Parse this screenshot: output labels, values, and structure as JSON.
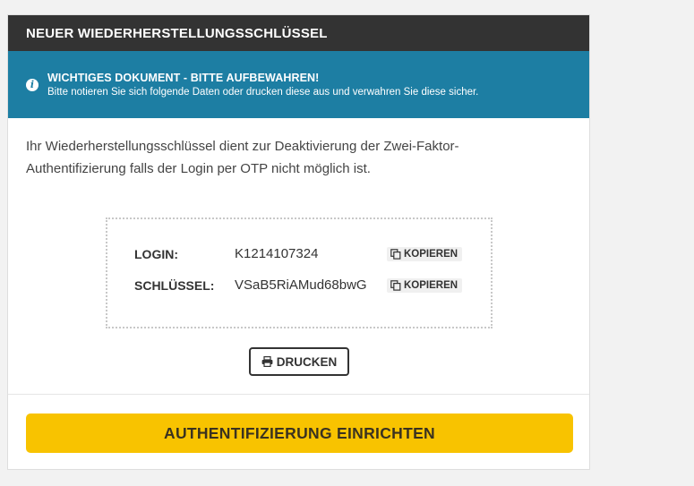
{
  "header": {
    "title": "NEUER WIEDERHERSTELLUNGSSCHLÜSSEL"
  },
  "notice": {
    "icon": "info-icon",
    "title": "WICHTIGES DOKUMENT - BITTE AUFBEWAHREN!",
    "text": "Bitte notieren Sie sich folgende Daten oder drucken diese aus und verwahren Sie diese sicher.",
    "background": "#1d7ea3"
  },
  "intro": "Ihr Wiederherstellungsschlüssel dient zur Deaktivierung der Zwei-Faktor-Authentifizierung falls der Login per OTP nicht möglich ist.",
  "credentials": [
    {
      "label": "LOGIN:",
      "value": "K1214107324",
      "copy_label": "KOPIEREN",
      "copy_icon": "copy-icon"
    },
    {
      "label": "SCHLÜSSEL:",
      "value": "VSaB5RiAMud68bwG",
      "copy_label": "KOPIEREN",
      "copy_icon": "copy-icon"
    }
  ],
  "print_button": {
    "label": "DRUCKEN",
    "icon": "printer-icon"
  },
  "cta_button": {
    "label": "AUTHENTIFIZIERUNG EINRICHTEN",
    "color": "#f8c300"
  }
}
